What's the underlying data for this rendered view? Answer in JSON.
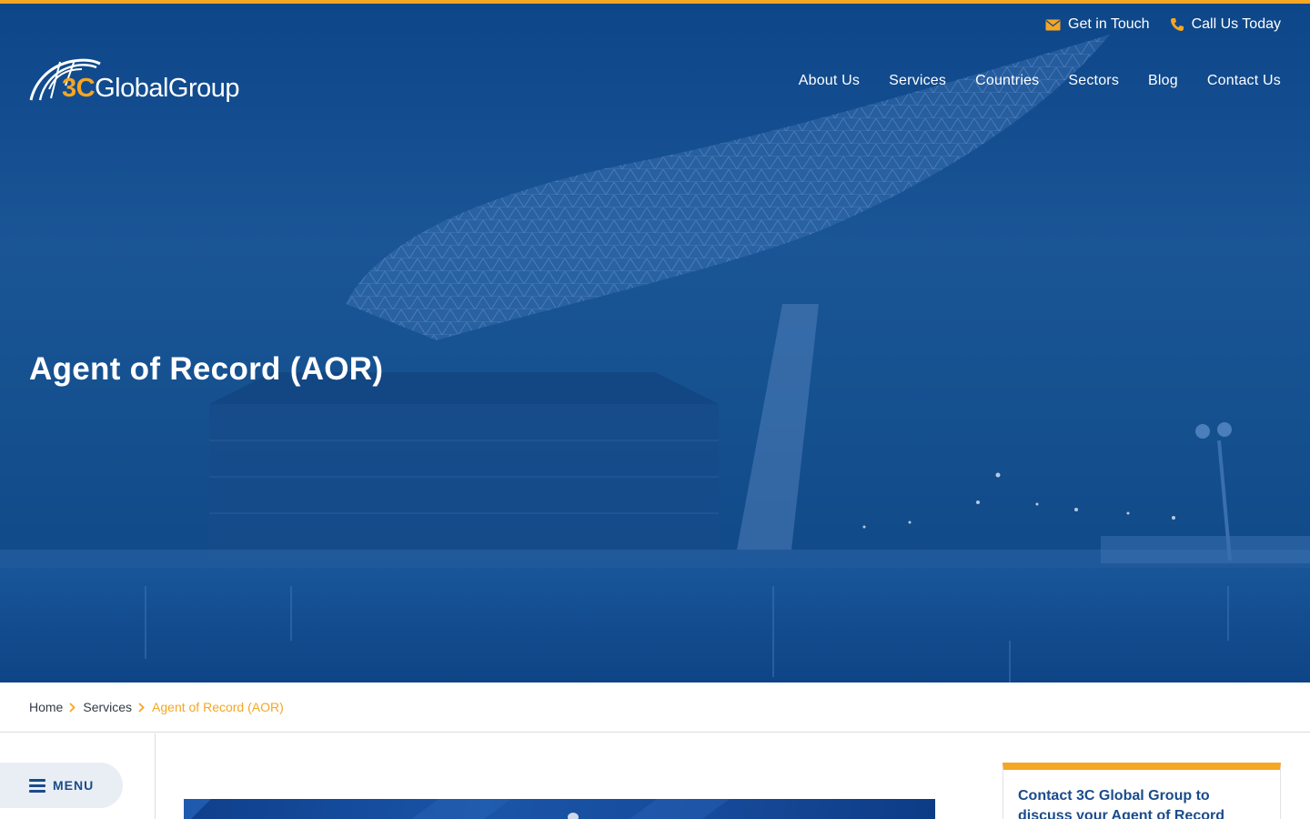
{
  "utility_nav": {
    "get_in_touch": "Get in Touch",
    "call_us": "Call Us Today"
  },
  "logo": {
    "accent": "3C",
    "rest": "GlobalGroup"
  },
  "main_nav": {
    "items": [
      "About Us",
      "Services",
      "Countries",
      "Sectors",
      "Blog",
      "Contact Us"
    ]
  },
  "hero": {
    "title": "Agent of Record (AOR)"
  },
  "breadcrumb": {
    "home": "Home",
    "services": "Services",
    "current": "Agent of Record (AOR)"
  },
  "sidebar": {
    "menu_label": "MENU"
  },
  "contact_card": {
    "text": "Contact 3C Global Group to discuss your Agent of Record"
  },
  "colors": {
    "accent": "#f5a623",
    "primary": "#1a4b8c",
    "hero_overlay": "#12508f"
  }
}
